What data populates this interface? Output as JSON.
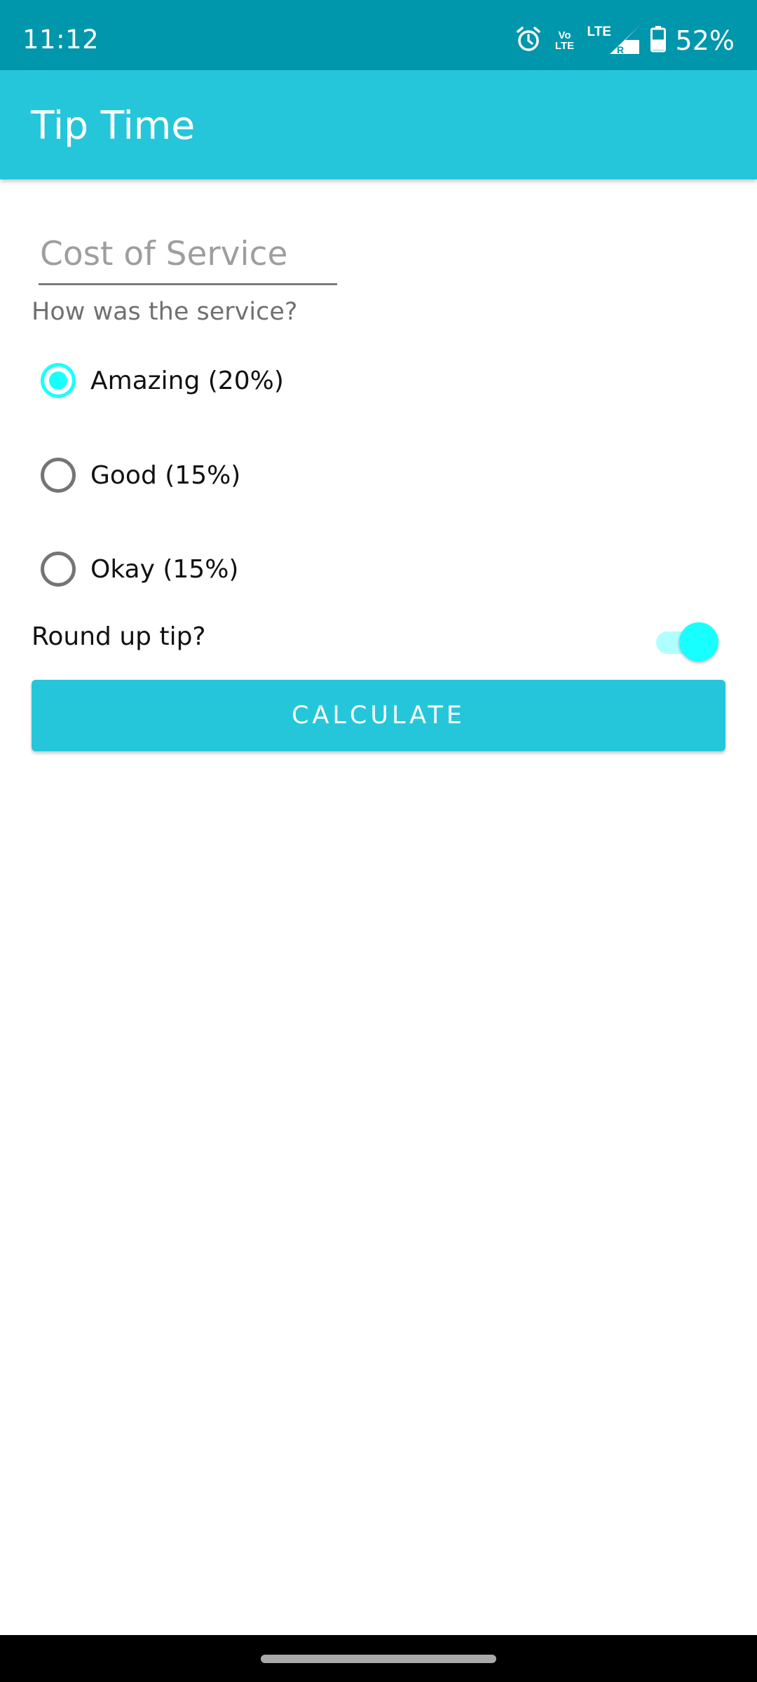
{
  "status_bar": {
    "time": "11:12",
    "volte_line1": "Vo",
    "volte_line2": "LTE",
    "network_label": "LTE",
    "roaming_label": "R",
    "battery_percent": "52%",
    "battery_level": 0.52,
    "icons": [
      "alarm-icon",
      "volte-icon",
      "signal-icon",
      "battery-icon"
    ],
    "background_color": "#0096AB"
  },
  "app_bar": {
    "title": "Tip Time",
    "background_color": "#26C6DA"
  },
  "form": {
    "cost_field": {
      "placeholder": "Cost of Service",
      "value": ""
    },
    "service_question": "How was the service?",
    "options": [
      {
        "label": "Amazing (20%)",
        "selected": true
      },
      {
        "label": "Good (15%)",
        "selected": false
      },
      {
        "label": "Okay (15%)",
        "selected": false
      }
    ],
    "round_up_label": "Round up tip?",
    "round_up_enabled": true,
    "calculate_label": "CALCULATE",
    "accent_color": "#18FFFF"
  }
}
